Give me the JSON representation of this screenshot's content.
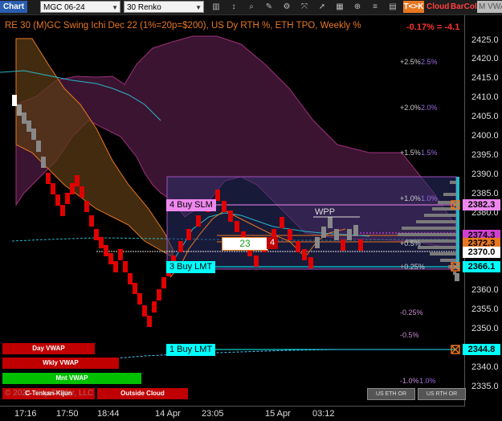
{
  "toolbar": {
    "chart_tab": "Chart",
    "symbol": "MGC 06-24",
    "interval": "30 Renko",
    "tk_button": "T<>K",
    "cloud_button": "Cloud",
    "barcol_button": "BarCol",
    "mvwap_button": "M VWA"
  },
  "legend": {
    "title": "RE 30 (M)GC Swing Ichi Dec 22 (1%=20p=$200), US Dy RTH %, ETH TPO, Weekly %",
    "change": "-0.17% = -4.1"
  },
  "price_axis": {
    "labels": [
      "2425.0",
      "2420.0",
      "2415.0",
      "2410.0",
      "2405.0",
      "2400.0",
      "2395.0",
      "2390.0",
      "2385.0",
      "2380.0",
      "2375.0",
      "2370.0",
      "2365.0",
      "2360.0",
      "2355.0",
      "2350.0",
      "2345.0",
      "2340.0",
      "2335.0"
    ],
    "tags": {
      "slm": "2382.3",
      "a": "2374.3",
      "b": "2372.3",
      "last": "2370.0",
      "buy3": "2366.1",
      "buy1": "2344.8"
    }
  },
  "time_axis": [
    "17:16",
    "17:50",
    "18:44",
    "14 Apr",
    "23:05",
    "15 Apr",
    "03:12"
  ],
  "orders": {
    "buy_slm": "4 Buy SLM",
    "buy_lmt3": "3 Buy LMT",
    "buy_lmt1": "1 Buy LMT",
    "counter_green": "23",
    "counter_red": "4",
    "wpp": "WPP"
  },
  "pct_levels": {
    "p25a": "+2.5%",
    "p25b": "2.5%",
    "p20a": "+2.0%",
    "p20b": "2.0%",
    "p15a": "+1.5%",
    "p15b": "1.5%",
    "p10a": "+1.0%",
    "p10b": "1.0%",
    "p05": "+0.5%",
    "p025": "+0.25%",
    "m025": "-0.25%",
    "m05": "-0.5%",
    "m10a": "-1.0%",
    "m10b": "1.0%"
  },
  "buttons": {
    "day_vwap": "Day VWAP",
    "wkly_vwap": "Wkly VWAP",
    "mnt_vwap": "Mnt VWAP",
    "tenkan_kijun": "C-Tenkan-Kijun",
    "outside_cloud": "Outside Cloud",
    "us_eth_or": "US ETH OR",
    "us_rth_or": "US RTH OR"
  },
  "copyright": "© 2024 NinjaTrader, LLC",
  "colors": {
    "accent": "#e87722",
    "bull_bar": "#888888",
    "bear_bar": "#e00000",
    "cloud_purple": "#6a2a5a",
    "orders_cyan": "#00ffff",
    "slm_pink": "#ee88ee"
  }
}
